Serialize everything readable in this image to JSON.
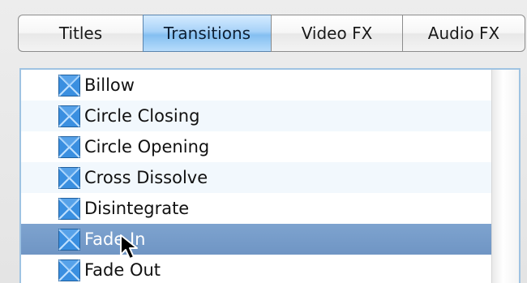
{
  "tabs": [
    {
      "label": "Titles",
      "selected": false
    },
    {
      "label": "Transitions",
      "selected": true
    },
    {
      "label": "Video FX",
      "selected": false
    },
    {
      "label": "Audio FX",
      "selected": false
    }
  ],
  "transitions": [
    {
      "label": "Billow",
      "icon": "transition-icon",
      "selected": false
    },
    {
      "label": "Circle Closing",
      "icon": "transition-icon",
      "selected": false
    },
    {
      "label": "Circle Opening",
      "icon": "transition-icon",
      "selected": false
    },
    {
      "label": "Cross Dissolve",
      "icon": "transition-icon",
      "selected": false
    },
    {
      "label": "Disintegrate",
      "icon": "transition-icon",
      "selected": false
    },
    {
      "label": "Fade In",
      "icon": "transition-icon",
      "selected": true
    },
    {
      "label": "Fade Out",
      "icon": "transition-icon",
      "selected": false
    }
  ],
  "colors": {
    "selected_tab": "#9cccf5",
    "selected_row": "#7499c7",
    "icon_fill": "#3a8fe0"
  }
}
